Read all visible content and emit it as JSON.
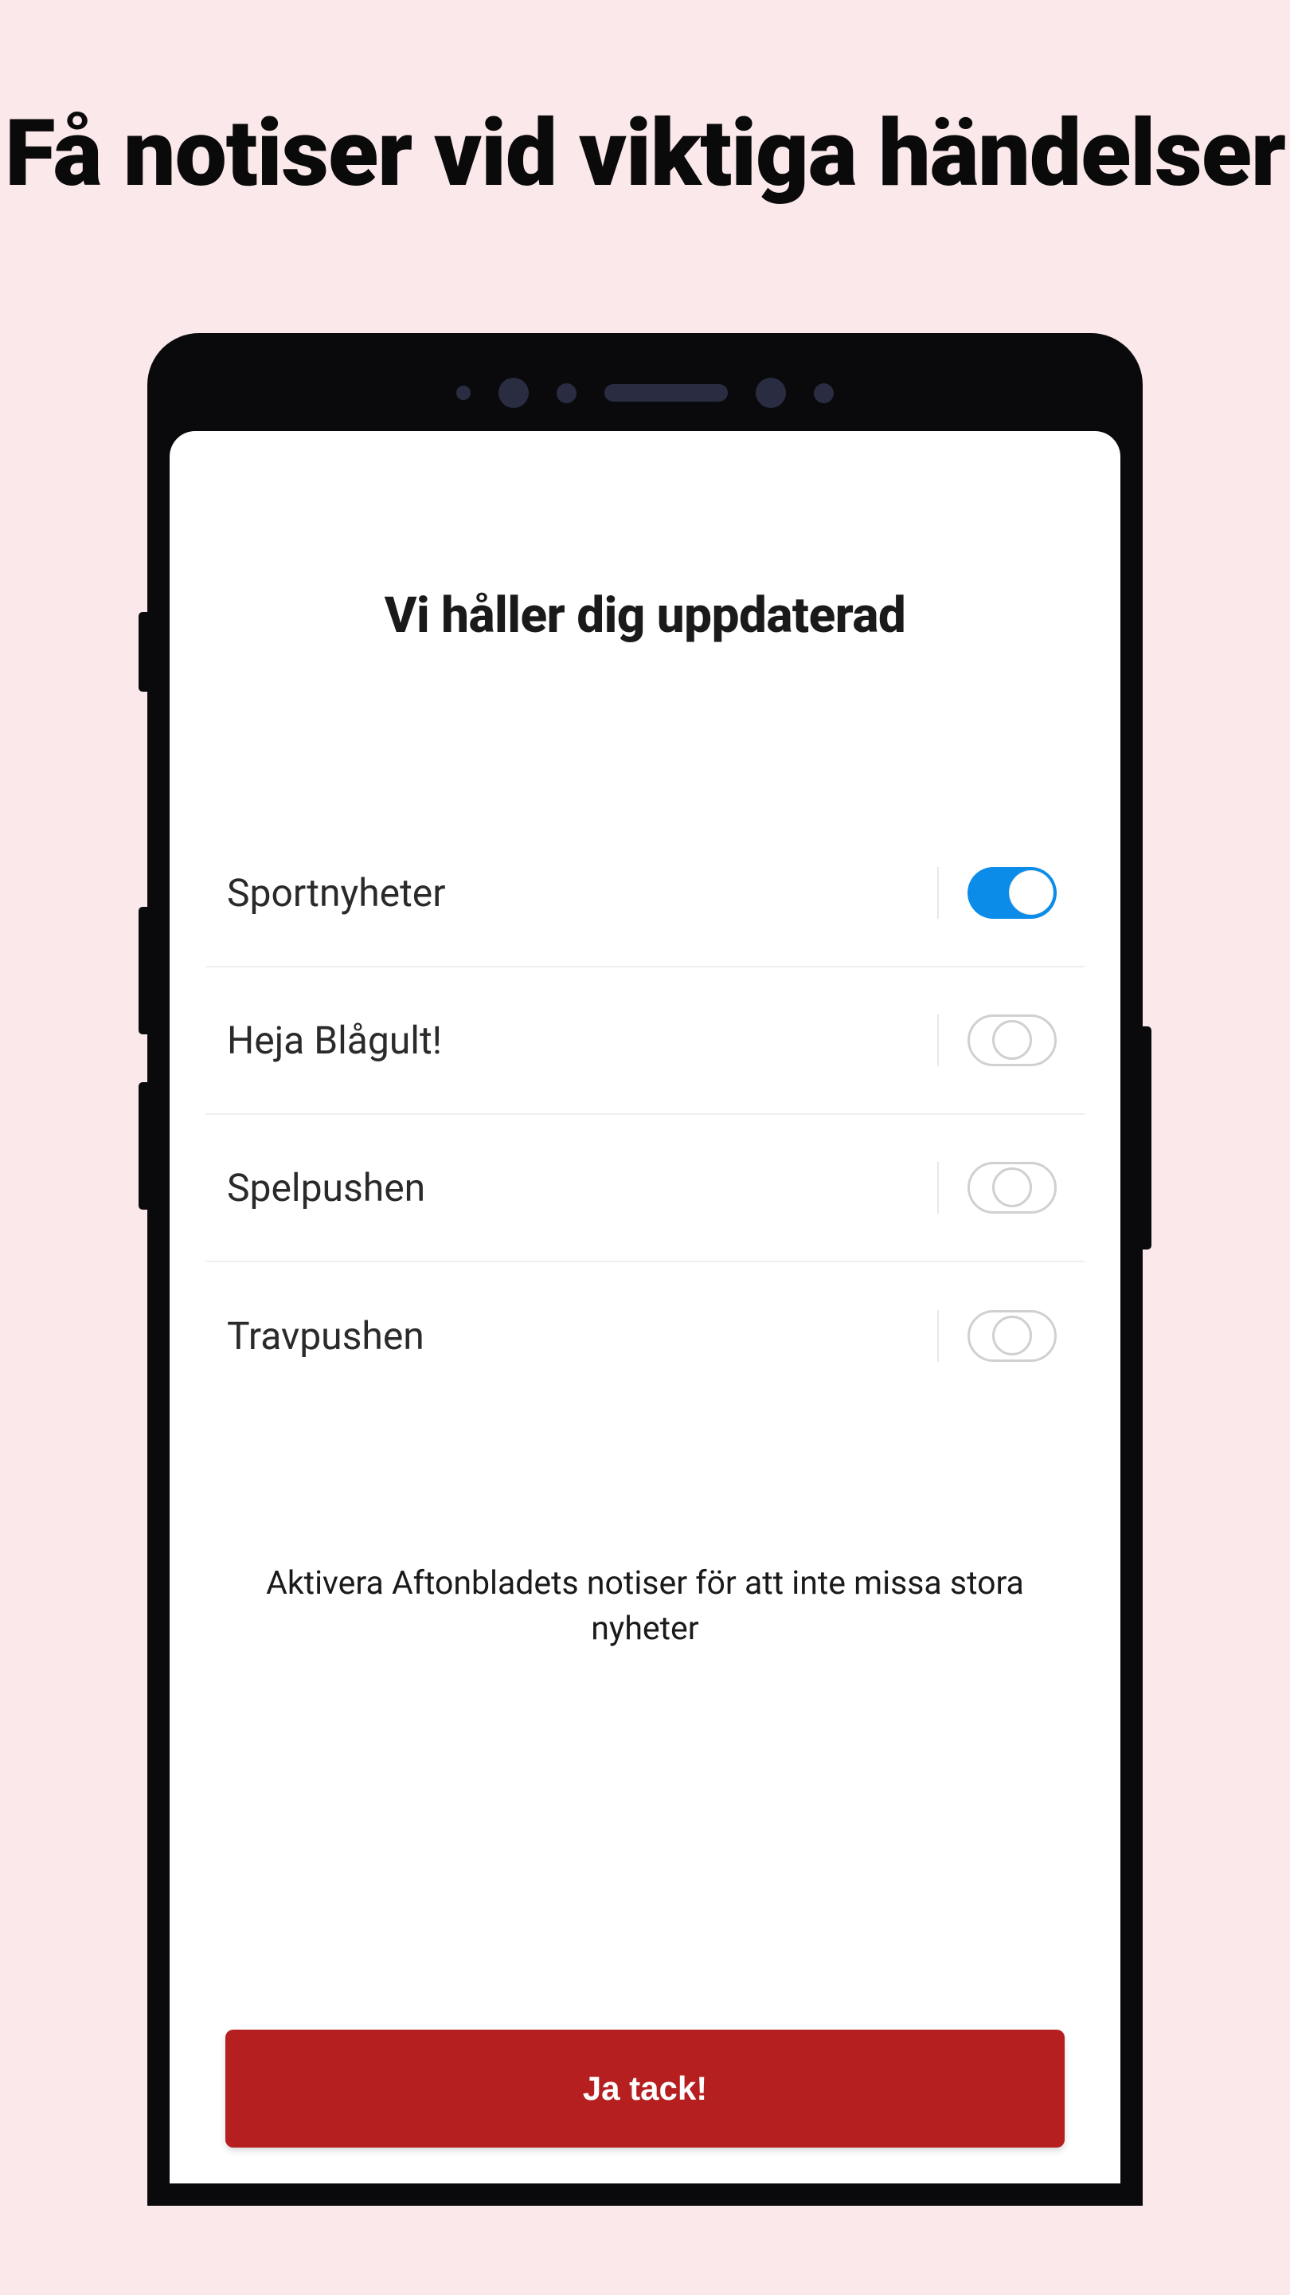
{
  "promo_heading": "Få notiser vid viktiga händelser",
  "screen": {
    "title": "Vi håller dig uppdaterad",
    "settings": [
      {
        "label": "Sportnyheter",
        "enabled": true
      },
      {
        "label": "Heja Blågult!",
        "enabled": false
      },
      {
        "label": "Spelpushen",
        "enabled": false
      },
      {
        "label": "Travpushen",
        "enabled": false
      }
    ],
    "description": "Aktivera Aftonbladets notiser för att inte missa stora nyheter",
    "primary_button_label": "Ja tack!"
  }
}
